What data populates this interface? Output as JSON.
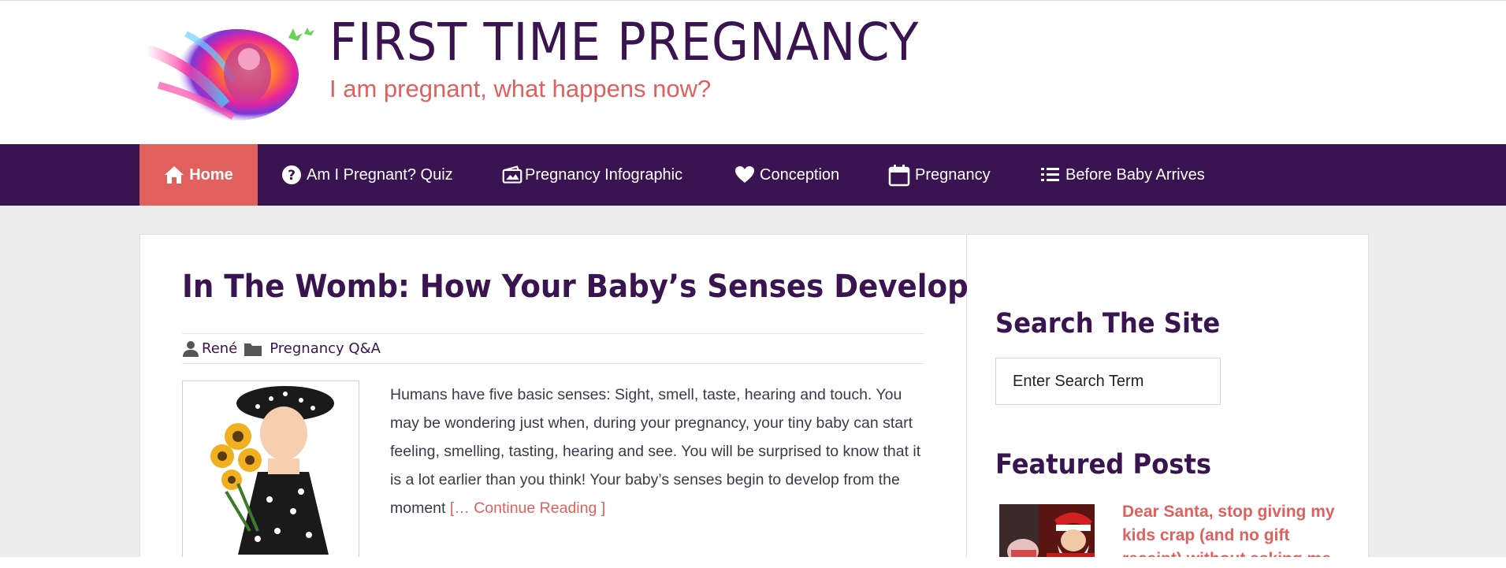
{
  "site": {
    "title": "FIRST TIME PREGNANCY",
    "tagline": "I am pregnant, what happens now?",
    "logo_icon": "rainbow-baby-logo-icon"
  },
  "colors": {
    "brand_purple": "#3a1450",
    "accent_coral": "#e0605e",
    "page_bg": "#ececec"
  },
  "nav": {
    "items": [
      {
        "label": "Home",
        "icon": "home-icon",
        "active": true
      },
      {
        "label": "Am I Pregnant? Quiz",
        "icon": "question-circle-icon"
      },
      {
        "label": "Pregnancy Infographic",
        "icon": "picture-icon"
      },
      {
        "label": "Conception",
        "icon": "heart-icon"
      },
      {
        "label": "Pregnancy",
        "icon": "calendar-icon"
      },
      {
        "label": "Before Baby Arrives",
        "icon": "list-icon"
      }
    ]
  },
  "post": {
    "title": "In The Womb: How Your Baby’s Senses Develop",
    "author": "René",
    "category": "Pregnancy Q&A",
    "excerpt": "Humans have five basic senses: Sight, smell, taste, hearing and touch. You may be wondering just when, during your pregnancy, your tiny baby can start feeling, smelling, tasting, hearing and see. You will be surprised to know that it is a lot earlier than you think! Your baby’s senses begin to develop from the moment ",
    "read_more": "[… Continue Reading ]"
  },
  "sidebar": {
    "search_title": "Search The Site",
    "search_placeholder": "Enter Search Term",
    "featured_title": "Featured Posts",
    "featured_post": "Dear Santa, stop giving my kids crap (and no gift receipt) without asking me"
  }
}
